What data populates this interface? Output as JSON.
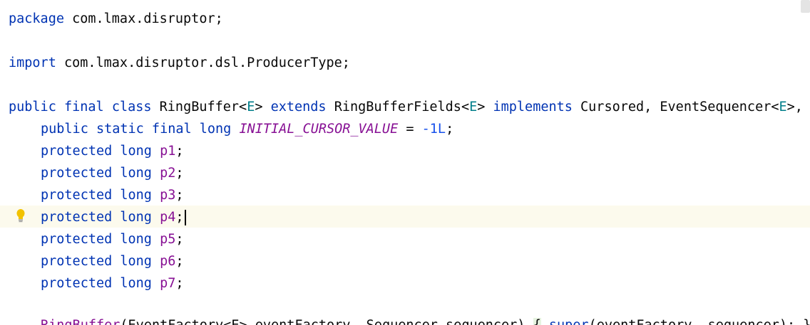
{
  "code": {
    "package_keyword": "package",
    "package_name": "com.lmax.disruptor;",
    "import_keyword": "import",
    "import_name": "com.lmax.disruptor.dsl.ProducerType;",
    "class_decl": {
      "public": "public",
      "final": "final",
      "class": "class",
      "name": "RingBuffer",
      "tp_open": "<",
      "tp": "E",
      "tp_close": ">",
      "extends": "extends",
      "super_name": "RingBufferFields",
      "implements": "implements",
      "interfaces": "Cursored, EventSequencer",
      "tail": ",  "
    },
    "constant_line": {
      "modifiers": "public static final long",
      "name": "INITIAL_CURSOR_VALUE",
      "equals": " = ",
      "value": "-1L",
      "semicolon": ";"
    },
    "fields": [
      {
        "modifiers": "protected long",
        "name": "p1",
        "semicolon": ";"
      },
      {
        "modifiers": "protected long",
        "name": "p2",
        "semicolon": ";"
      },
      {
        "modifiers": "protected long",
        "name": "p3",
        "semicolon": ";"
      },
      {
        "modifiers": "protected long",
        "name": "p4",
        "semicolon": ";"
      },
      {
        "modifiers": "protected long",
        "name": "p5",
        "semicolon": ";"
      },
      {
        "modifiers": "protected long",
        "name": "p6",
        "semicolon": ";"
      },
      {
        "modifiers": "protected long",
        "name": "p7",
        "semicolon": ";"
      }
    ],
    "constructor_line": {
      "name": "RingBuffer",
      "params": "(EventFactory<E> eventFactory, Sequencer sequencer) ",
      "brace": "{",
      "super_kw": "super",
      "args": "(eventFactory, sequencer); }"
    }
  },
  "editor": {
    "current_line_highlight": "#fcfaed",
    "intention_icon": "lightbulb-icon"
  }
}
